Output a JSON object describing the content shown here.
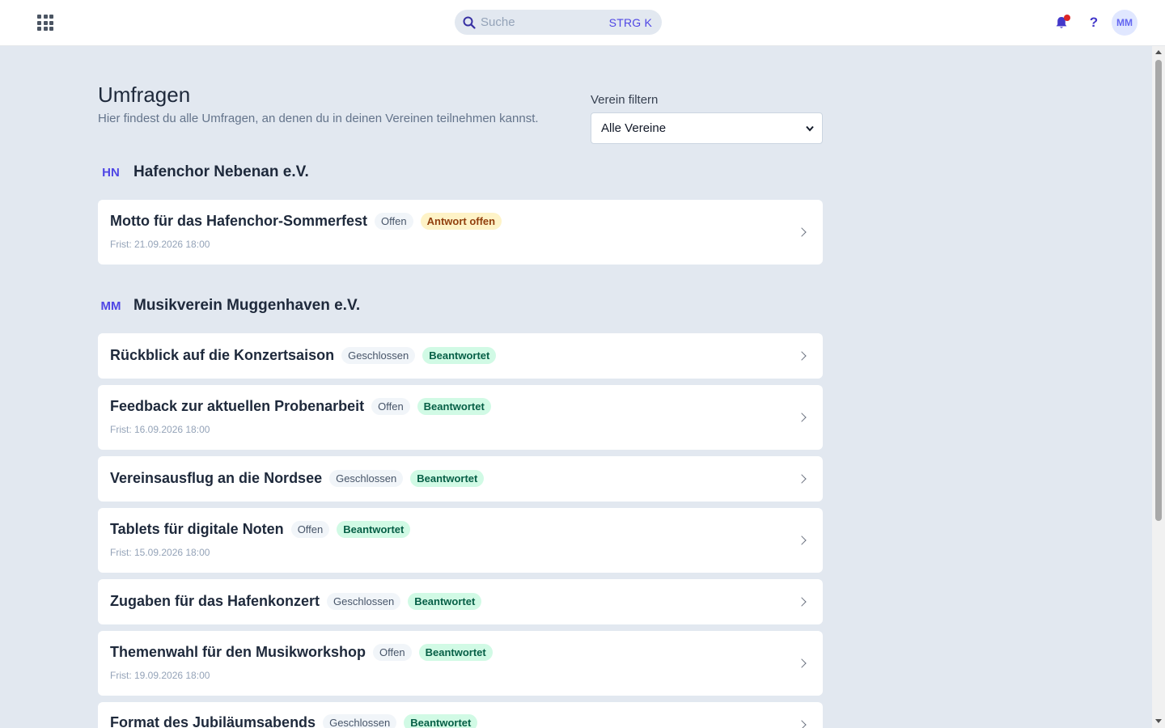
{
  "header": {
    "search": {
      "placeholder": "Suche",
      "shortcut": "STRG K"
    },
    "help_label": "?",
    "avatar_initials": "MM"
  },
  "page": {
    "title": "Umfragen",
    "description": "Hier findest du alle Umfragen, an denen du in deinen Vereinen teilnehmen kannst.",
    "filter": {
      "label": "Verein filtern",
      "selected": "Alle Vereine"
    }
  },
  "clubs": [
    {
      "initials": "HN",
      "name": "Hafenchor Nebenan e.V.",
      "surveys": [
        {
          "title": "Motto für das Hafenchor-Sommerfest",
          "status": "Offen",
          "answer": "Antwort offen",
          "deadline": "Frist: 21.09.2026 18:00"
        }
      ]
    },
    {
      "initials": "MM",
      "name": "Musikverein Muggenhaven e.V.",
      "surveys": [
        {
          "title": "Rückblick auf die Konzertsaison",
          "status": "Geschlossen",
          "answer": "Beantwortet"
        },
        {
          "title": "Feedback zur aktuellen Probenarbeit",
          "status": "Offen",
          "answer": "Beantwortet",
          "deadline": "Frist: 16.09.2026 18:00"
        },
        {
          "title": "Vereinsausflug an die Nordsee",
          "status": "Geschlossen",
          "answer": "Beantwortet"
        },
        {
          "title": "Tablets für digitale Noten",
          "status": "Offen",
          "answer": "Beantwortet",
          "deadline": "Frist: 15.09.2026 18:00"
        },
        {
          "title": "Zugaben für das Hafenkonzert",
          "status": "Geschlossen",
          "answer": "Beantwortet"
        },
        {
          "title": "Themenwahl für den Musikworkshop",
          "status": "Offen",
          "answer": "Beantwortet",
          "deadline": "Frist: 19.09.2026 18:00"
        },
        {
          "title": "Format des Jubiläumsabends",
          "status": "Geschlossen",
          "answer": "Beantwortet"
        }
      ]
    }
  ],
  "icons": {
    "apps": "apps-grid-icon",
    "search": "search-icon",
    "notifications": "bell-icon",
    "help": "help-icon",
    "chevron": "chevron-right-icon",
    "select": "chevron-down-icon"
  },
  "colors": {
    "accent": "#4f46e5",
    "notification_dot": "#dc2626",
    "answer_open_bg": "#fef3c7",
    "answered_bg": "#d1fae5"
  }
}
